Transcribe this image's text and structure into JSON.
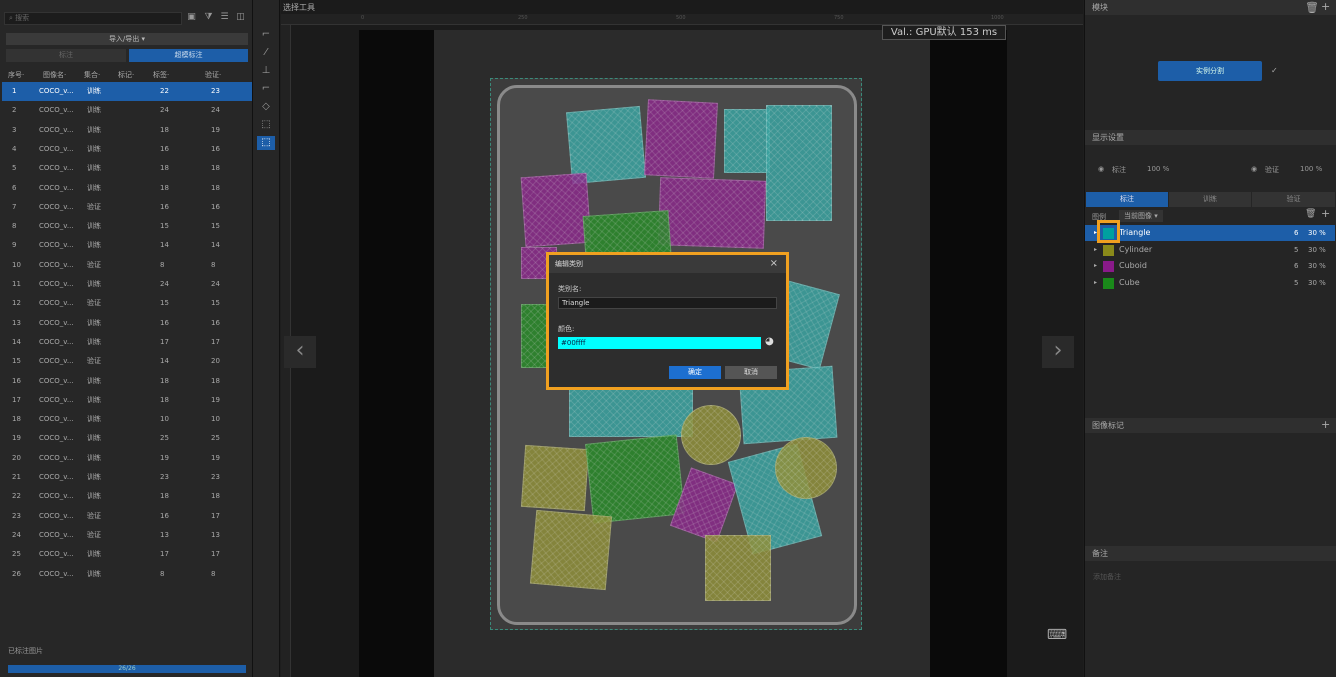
{
  "left": {
    "search_placeholder": "搜索",
    "io_label": "导入/导出 ▾",
    "tabs": [
      "标注",
      "超模标注"
    ],
    "columns": [
      "序号·",
      "图像名·",
      "集合·",
      "标记·",
      "标签·",
      "验证·"
    ],
    "rows": [
      [
        "1",
        "COCO_v...",
        "训练",
        "",
        "22",
        "23"
      ],
      [
        "2",
        "COCO_v...",
        "训练",
        "",
        "24",
        "24"
      ],
      [
        "3",
        "COCO_v...",
        "训练",
        "",
        "18",
        "19"
      ],
      [
        "4",
        "COCO_v...",
        "训练",
        "",
        "16",
        "16"
      ],
      [
        "5",
        "COCO_v...",
        "训练",
        "",
        "18",
        "18"
      ],
      [
        "6",
        "COCO_v...",
        "训练",
        "",
        "18",
        "18"
      ],
      [
        "7",
        "COCO_v...",
        "验证",
        "",
        "16",
        "16"
      ],
      [
        "8",
        "COCO_v...",
        "训练",
        "",
        "15",
        "15"
      ],
      [
        "9",
        "COCO_v...",
        "训练",
        "",
        "14",
        "14"
      ],
      [
        "10",
        "COCO_v...",
        "验证",
        "",
        "8",
        "8"
      ],
      [
        "11",
        "COCO_v...",
        "训练",
        "",
        "24",
        "24"
      ],
      [
        "12",
        "COCO_v...",
        "验证",
        "",
        "15",
        "15"
      ],
      [
        "13",
        "COCO_v...",
        "训练",
        "",
        "16",
        "16"
      ],
      [
        "14",
        "COCO_v...",
        "训练",
        "",
        "17",
        "17"
      ],
      [
        "15",
        "COCO_v...",
        "验证",
        "",
        "14",
        "20"
      ],
      [
        "16",
        "COCO_v...",
        "训练",
        "",
        "18",
        "18"
      ],
      [
        "17",
        "COCO_v...",
        "训练",
        "",
        "18",
        "19"
      ],
      [
        "18",
        "COCO_v...",
        "训练",
        "",
        "10",
        "10"
      ],
      [
        "19",
        "COCO_v...",
        "训练",
        "",
        "25",
        "25"
      ],
      [
        "20",
        "COCO_v...",
        "训练",
        "",
        "19",
        "19"
      ],
      [
        "21",
        "COCO_v...",
        "训练",
        "",
        "23",
        "23"
      ],
      [
        "22",
        "COCO_v...",
        "训练",
        "",
        "18",
        "18"
      ],
      [
        "23",
        "COCO_v...",
        "验证",
        "",
        "16",
        "17"
      ],
      [
        "24",
        "COCO_v...",
        "验证",
        "",
        "13",
        "13"
      ],
      [
        "25",
        "COCO_v...",
        "训练",
        "",
        "17",
        "17"
      ],
      [
        "26",
        "COCO_v...",
        "训练",
        "",
        "8",
        "8"
      ]
    ],
    "footer_label": "已标注图片",
    "progress_text": "26/26",
    "progress_value": 1.0
  },
  "canvas": {
    "tool_name": "选择工具",
    "ruler_ticks": [
      "0",
      "250",
      "500",
      "750",
      "1000"
    ],
    "val_label": "Val.: GPU默认 153 ms"
  },
  "dialog": {
    "title": "编辑类别",
    "name_label": "类别名:",
    "name_value": "Triangle",
    "color_label": "颜色:",
    "color_value": "#00ffff",
    "ok_label": "确定",
    "cancel_label": "取消"
  },
  "right": {
    "module_header": "模块",
    "module_button": "实例分割",
    "display_header": "显示设置",
    "label_text": "标注",
    "label_pct": "100 %",
    "verify_text": "验证",
    "verify_pct": "100 %",
    "tabs": [
      "标注",
      "训练",
      "验证"
    ],
    "legend_label": "图例",
    "legend_scope": "当前图像 ▾",
    "classes": [
      {
        "name": "Triangle",
        "count": "6",
        "pct": "30 %",
        "color": "#00a0a0"
      },
      {
        "name": "Cylinder",
        "count": "5",
        "pct": "30 %",
        "color": "#8a8a1a"
      },
      {
        "name": "Cuboid",
        "count": "6",
        "pct": "30 %",
        "color": "#8a1a8a"
      },
      {
        "name": "Cube",
        "count": "5",
        "pct": "30 %",
        "color": "#1a8a1a"
      }
    ],
    "image_tag_header": "图像标记",
    "note_header": "备注",
    "note_placeholder": "添加备注"
  },
  "colors": {
    "accent": "#1d5ea8",
    "highlight": "#f0a020"
  }
}
